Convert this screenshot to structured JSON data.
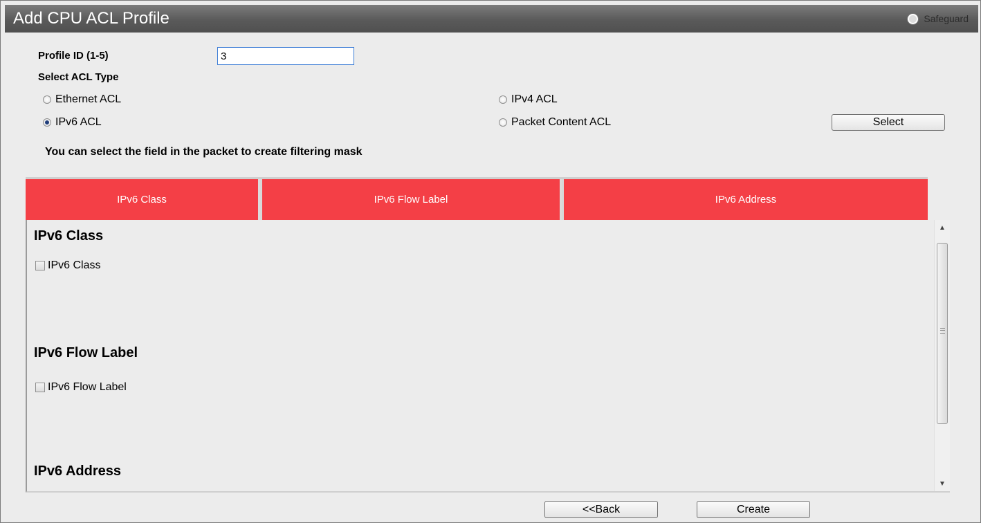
{
  "window": {
    "title": "Add CPU ACL Profile",
    "safeguard_label": "Safeguard"
  },
  "form": {
    "profile_id_label": "Profile ID (1-5)",
    "profile_id_value": "3",
    "acl_type_label": "Select ACL Type",
    "acl_types": [
      {
        "label": "Ethernet ACL",
        "selected": false
      },
      {
        "label": "IPv4 ACL",
        "selected": false
      },
      {
        "label": "IPv6 ACL",
        "selected": true
      },
      {
        "label": "Packet Content ACL",
        "selected": false
      }
    ],
    "select_button": "Select",
    "hint": "You can select the field in the packet to create filtering mask"
  },
  "tabs": [
    "IPv6 Class",
    "IPv6 Flow Label",
    "IPv6 Address"
  ],
  "sections": [
    {
      "heading": "IPv6 Class",
      "checkbox": "IPv6 Class",
      "checked": false
    },
    {
      "heading": "IPv6 Flow Label",
      "checkbox": "IPv6 Flow Label",
      "checked": false
    },
    {
      "heading": "IPv6 Address"
    }
  ],
  "buttons": {
    "back": "<<Back",
    "create": "Create"
  },
  "colors": {
    "tab_red": "#f43f46",
    "title_bar": "#5a5a5a"
  }
}
